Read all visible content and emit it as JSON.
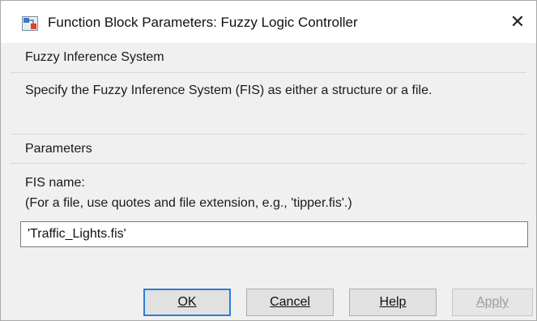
{
  "window": {
    "title": "Function Block Parameters: Fuzzy Logic Controller",
    "close_glyph": "✕"
  },
  "fis_section": {
    "header": "Fuzzy Inference System",
    "description": "Specify the Fuzzy Inference System (FIS) as either a structure or a file."
  },
  "params_section": {
    "header": "Parameters",
    "field_label_line1": "FIS name:",
    "field_label_line2": "(For a file, use quotes and file extension, e.g., 'tipper.fis'.)",
    "field_value": "'Traffic_Lights.fis'"
  },
  "buttons": {
    "ok": "OK",
    "cancel": "Cancel",
    "help": "Help",
    "apply": "Apply"
  },
  "colors": {
    "dialog_bg": "#f0f0f0",
    "titlebar_bg": "#ffffff",
    "primary_border": "#2d7bd6",
    "disabled_text": "#9a9a9a"
  }
}
